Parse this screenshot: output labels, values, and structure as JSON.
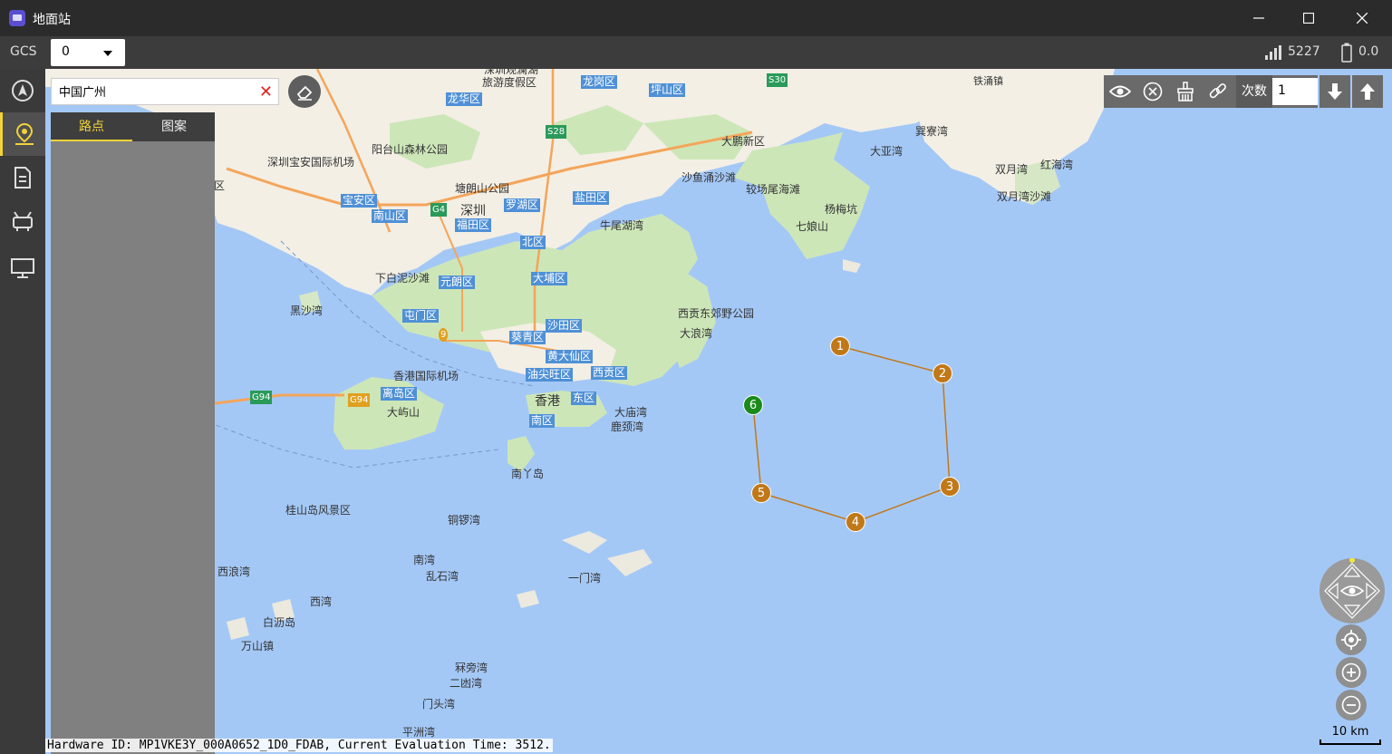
{
  "window": {
    "title": "地面站",
    "controls": [
      "minimize",
      "maximize",
      "close"
    ]
  },
  "toolbar": {
    "gcs_label": "GCS",
    "gcs_value": "0",
    "signal_value": "5227",
    "battery_value": "0.0"
  },
  "sidebar": {
    "items": [
      {
        "icon": "navigation-icon"
      },
      {
        "icon": "location-pin-icon",
        "active": true
      },
      {
        "icon": "document-icon"
      },
      {
        "icon": "drone-icon"
      },
      {
        "icon": "monitor-icon"
      }
    ]
  },
  "search": {
    "value": "中国广州"
  },
  "panel": {
    "tabs": [
      "路点",
      "图案"
    ],
    "active_tab": "路点"
  },
  "route_tools": {
    "count_label": "次数",
    "count_value": "1"
  },
  "map": {
    "scale": "10 km",
    "labels": {
      "lingtou": "阳台山森林公园",
      "airport_sz": "深圳宝安国际机场",
      "shenzhen": "深圳",
      "tanglang": "塘朗山公园",
      "dapeng": "大鹏新区",
      "shayu": "沙鱼涌沙滩",
      "jiaochang": "较场尾海滩",
      "yangmei": "杨梅坑",
      "qiniang": "七娘山",
      "dayawan": "大亚湾",
      "xunliao": "巽寮湾",
      "shuangyue": "双月湾",
      "honghai": "红海湾",
      "shuangyue_beach": "双月湾沙滩",
      "niuwei": "牛尾湖湾",
      "xiabai": "下白泥沙滩",
      "heisha": "黑沙湾",
      "saikung": "西贡东郊野公园",
      "dalang": "大浪湾",
      "hkairport": "香港国际机场",
      "hongkong": "香港",
      "dayushan": "大屿山",
      "datan": "大庙湾",
      "lujing": "鹿颈湾",
      "nanya": "南丫岛",
      "guishan": "桂山岛风景区",
      "tongluo": "铜锣湾",
      "nanwan": "南湾",
      "luanshi": "乱石湾",
      "yimen": "一门湾",
      "xilang": "西浪湾",
      "xiwan": "西湾",
      "bailing": "白沥岛",
      "wanshan": "万山镇",
      "jiaoya": "冧旁湾",
      "ermen": "二凼湾",
      "menwei": "门头湾",
      "pingzhou": "平洲湾",
      "lvyou": "旅游度假区",
      "shenzhenguan": "深圳观澜湖",
      "tieyong": "铁涌镇"
    },
    "districts": {
      "longhua": "龙华区",
      "longgang": "龙岗区",
      "pingshan": "坪山区",
      "baoan": "宝安区",
      "nanshan": "南山区",
      "futian": "福田区",
      "luohu": "罗湖区",
      "yantian": "盐田区",
      "beiqu": "北区",
      "yuanlang": "元朗区",
      "dapu": "大埔区",
      "tunmen": "屯门区",
      "shatian": "沙田区",
      "kuiqing": "葵青区",
      "huangdaxian": "黄大仙区",
      "youjianwang": "油尖旺区",
      "xigong": "西贡区",
      "lidao": "离岛区",
      "dongqu": "东区",
      "nanqu": "南区",
      "left_qu": "区"
    },
    "road_labels": {
      "s28": "S28",
      "s30": "S30",
      "g4": "G4",
      "g94a": "G94",
      "g94b": "G94",
      "r9": "9"
    }
  },
  "waypoints": [
    {
      "id": "1",
      "color": "#c17818"
    },
    {
      "id": "2",
      "color": "#c17818"
    },
    {
      "id": "3",
      "color": "#c17818"
    },
    {
      "id": "4",
      "color": "#c17818"
    },
    {
      "id": "5",
      "color": "#c17818"
    },
    {
      "id": "6",
      "color": "#1a8a1a"
    }
  ],
  "watermark": "Hardware ID: MP1VKE3Y_000A0652_1D0_FDAB, Current Evaluation Time: 3512."
}
